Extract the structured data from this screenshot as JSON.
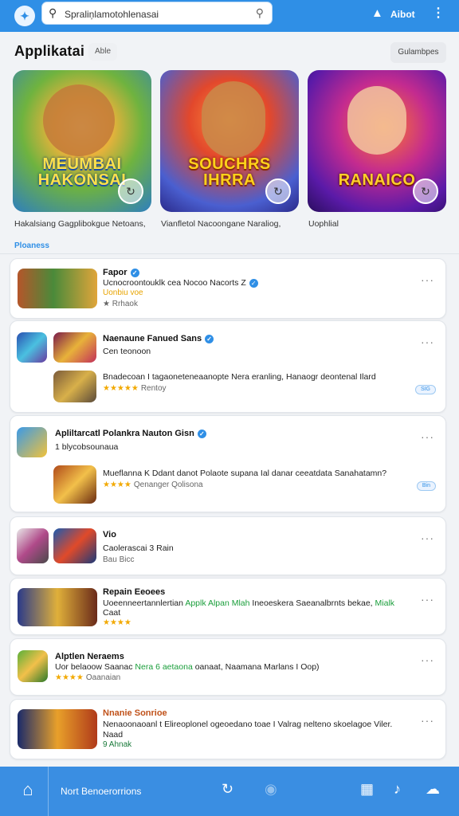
{
  "topbar": {
    "app_icon": "puzzle-icon",
    "search_text": "Spraliņlamotohlenasai",
    "user_label": "Aibot"
  },
  "section": {
    "title": "Applikatai",
    "chip": "Able",
    "button": "Gulambpes"
  },
  "featured": [
    {
      "title": "MEUMBAI\nHAKONSAI",
      "caption": "Hakalsiang Gagplibokgue Netoans,"
    },
    {
      "title": "SOUCHRS\nIHRRA",
      "caption": "Vianfletol Nacoongane Naraliog,"
    },
    {
      "title": "RANAICO",
      "caption": "Uophlial"
    }
  ],
  "sub_label": "Ploaness",
  "list": [
    {
      "title": "Fapor",
      "desc": "Ucnocroontouklk cea Nocoo Nacorts Z",
      "stars": "Uonbiu voe",
      "meta": "Rrhaok"
    },
    {
      "title": "Naenaune Fanued Sans",
      "desc": "Cen teonoon",
      "desc2": "Bnadecoan I tagaoneteneaanopte Nera eranling, Hanaogr deontenal Ilard",
      "stars": "★★★★★",
      "meta": "Rentoy",
      "pill": "SIG"
    },
    {
      "title": "Apliltarcatl Polankra Nauton Gisn",
      "desc": "1 blycobsounaua",
      "desc2": "Mueflanna K Ddant danot Polaote supana Ial danar ceeatdata Sanahatamn?",
      "stars": "★★★★",
      "meta": "Qenanger Qolisona",
      "pill": "Bin"
    },
    {
      "title": "Vio",
      "desc": "Caolerascai 3 Rain",
      "meta": "Bau Bicc"
    },
    {
      "title": "Repain Eeoees",
      "desc": "Uoeenneertannlertian",
      "desc_green": "Applk Alpan Mlah",
      "desc_tail": "Ineoeskera Saeanalbrnts bekae,",
      "desc_green2": "Mialk",
      "desc3": "Caat",
      "stars": "★★★★"
    },
    {
      "title": "Alptlen Neraems",
      "desc": "Uor belaoow Saanac",
      "desc_green": "Nera 6 aetaona",
      "desc_tail": "oanaat, Naamana Marlans I Oop)",
      "stars": "★★★★",
      "meta": "Oaanaian"
    },
    {
      "title": "Nnanie Sonrioe",
      "desc": "Nenaoonaoanl t Elireoplonel ogeoedano toae I Valrag nelteno skoelagoe Viler.",
      "desc3": "Naad",
      "stars": "9 Ahnak"
    }
  ],
  "bottomnav": {
    "label": "Nort Benoerorrions"
  }
}
